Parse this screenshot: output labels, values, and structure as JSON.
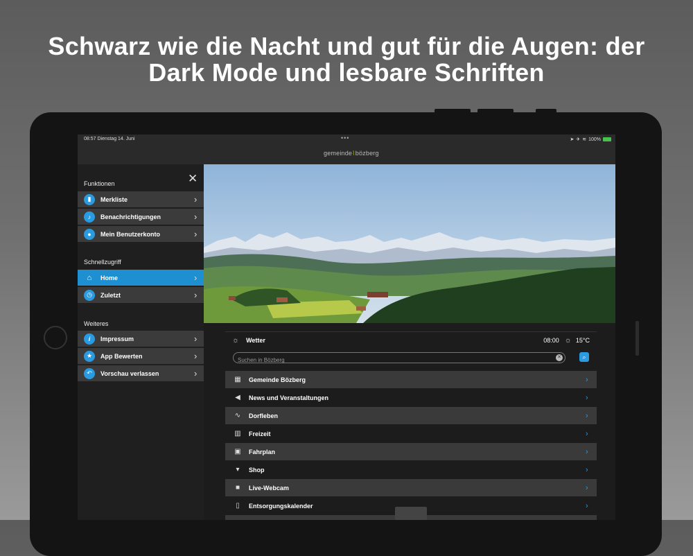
{
  "headline": {
    "line1": "Schwarz wie die Nacht und gut für die Augen: der",
    "line2": "Dark Mode und lesbare Schriften"
  },
  "status_bar": {
    "time_date": "08:57   Dienstag 14. Juni",
    "dots": "•••",
    "battery_text": "100%"
  },
  "app": {
    "logo_text": "gemeinde",
    "logo_text2": "bözberg"
  },
  "sidebar": {
    "sections": [
      {
        "title": "Funktionen",
        "items": [
          {
            "label": "Merkliste",
            "icon": "bookmark-icon"
          },
          {
            "label": "Benachrichtigungen",
            "icon": "bell-icon"
          },
          {
            "label": "Mein Benutzerkonto",
            "icon": "user-icon"
          }
        ]
      },
      {
        "title": "Schnellzugriff",
        "items": [
          {
            "label": "Home",
            "icon": "home-icon",
            "active": true
          },
          {
            "label": "Zuletzt",
            "icon": "clock-icon"
          }
        ]
      },
      {
        "title": "Weiteres",
        "items": [
          {
            "label": "Impressum",
            "icon": "info-icon"
          },
          {
            "label": "App Bewerten",
            "icon": "star-icon"
          },
          {
            "label": "Vorschau verlassen",
            "icon": "back-arrow-icon"
          }
        ]
      }
    ]
  },
  "weather": {
    "label": "Wetter",
    "time": "08:00",
    "temperature": "15°C"
  },
  "search": {
    "placeholder": "Suchen in Bözberg"
  },
  "nav": {
    "items": [
      {
        "label": "Gemeinde Bözberg",
        "icon": "building-icon"
      },
      {
        "label": "News und Veranstaltungen",
        "icon": "megaphone-icon"
      },
      {
        "label": "Dorfleben",
        "icon": "pulse-icon"
      },
      {
        "label": "Freizeit",
        "icon": "map-icon"
      },
      {
        "label": "Fahrplan",
        "icon": "bus-icon"
      },
      {
        "label": "Shop",
        "icon": "cart-icon"
      },
      {
        "label": "Live-Webcam",
        "icon": "video-camera-icon"
      },
      {
        "label": "Entsorgungskalender",
        "icon": "trash-icon"
      }
    ]
  },
  "colors": {
    "accent": "#1e8fd0",
    "background_dark": "#1c1c1c",
    "row_dark": "#3a3a3a"
  }
}
